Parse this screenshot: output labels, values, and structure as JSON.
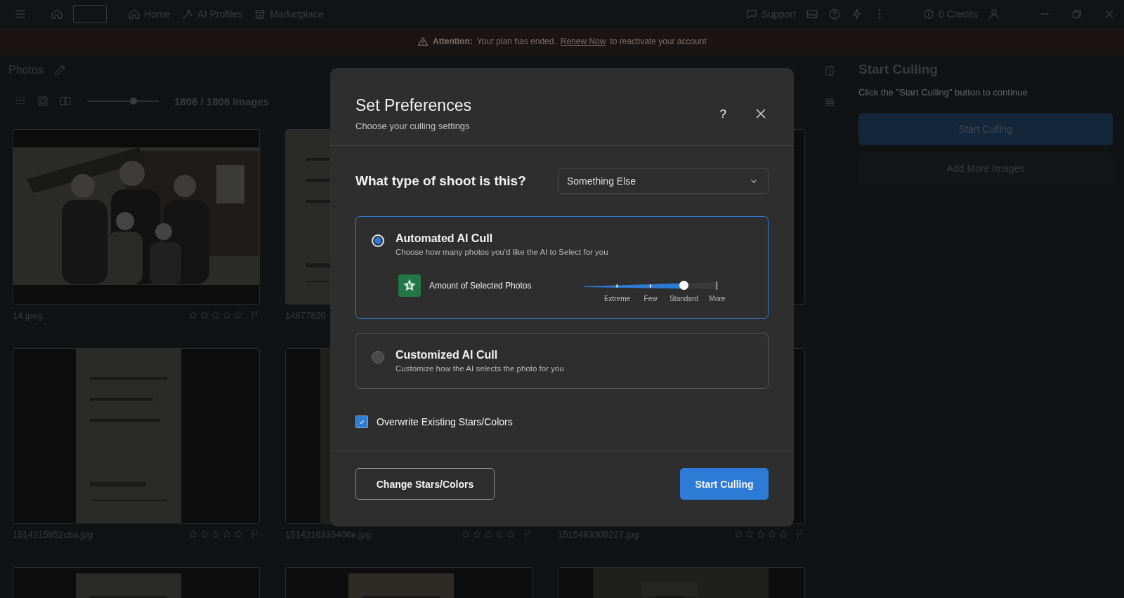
{
  "topbar": {
    "nav": [
      {
        "label": "Home"
      },
      {
        "label": "AI Profiles"
      },
      {
        "label": "Marketplace"
      }
    ],
    "support": "Support",
    "credits": "0 Credits"
  },
  "banner": {
    "label": "Attention:",
    "message": "Your plan has ended.",
    "link": "Renew Now",
    "tail": "to reactivate your account"
  },
  "gallery": {
    "title": "Photos",
    "size_slider": {
      "level": 0.65
    },
    "count": "1806 / 1806 Images",
    "photos": [
      {
        "kind": "picture",
        "filename": "14.jpeg",
        "stars": 0
      },
      {
        "kind": "picture",
        "filename": "14877820"
      },
      {
        "kind": "picture"
      },
      {
        "kind": "picture",
        "filename": "1514215852cba.jpg",
        "stars": 0
      },
      {
        "kind": "picture",
        "filename": "1514216335406e.jpg",
        "stars": 0
      },
      {
        "kind": "picture",
        "filename": "1515483009227.jpg",
        "stars": 0
      },
      {
        "kind": "picture"
      },
      {
        "kind": "picture"
      },
      {
        "kind": "picture"
      }
    ]
  },
  "panel": {
    "title": "Start Culling",
    "hint": "Click the \"Start Culling\" button to continue",
    "primary": "Start Culling",
    "secondary": "Add More Images"
  },
  "modal": {
    "title": "Set Preferences",
    "subtitle": "Choose your culling settings",
    "help": "?",
    "question": "What type of shoot is this?",
    "shoot_type": "Something Else",
    "options": [
      {
        "title": "Automated AI Cull",
        "description": "Choose how many photos you'd like the AI to Select for you",
        "selected": true,
        "amount": {
          "label": "Amount of Selected Photos",
          "badge": "5",
          "level": 0.75,
          "stops": [
            "Extreme",
            "Few",
            "Standard",
            "More"
          ]
        }
      },
      {
        "title": "Customized AI Cull",
        "description": "Customize how the AI selects the photo for you",
        "selected": false
      }
    ],
    "overwrite": {
      "label": "Overwrite Existing Stars/Colors",
      "checked": true
    },
    "buttons": [
      {
        "label": "Change Stars/Colors",
        "kind": "secondary"
      },
      {
        "label": "Start Culling",
        "kind": "primary"
      }
    ]
  }
}
